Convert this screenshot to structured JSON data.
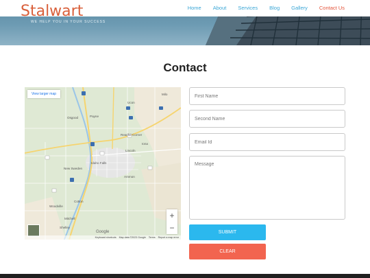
{
  "brand": {
    "logo": "Stalwart",
    "tagline": "WE HELP YOU IN YOUR SUCCESS"
  },
  "nav": {
    "items": [
      {
        "label": "Home",
        "active": false
      },
      {
        "label": "About",
        "active": false
      },
      {
        "label": "Services",
        "active": false
      },
      {
        "label": "Blog",
        "active": false
      },
      {
        "label": "Gallery",
        "active": false
      },
      {
        "label": "Contact Us",
        "active": true
      }
    ]
  },
  "page": {
    "title": "Contact"
  },
  "map": {
    "view_larger": "View larger map",
    "zoom_in": "+",
    "zoom_out": "−",
    "google": "Google",
    "footer": {
      "shortcuts": "Keyboard shortcuts",
      "data": "Map data ©2023 Google",
      "terms": "Terms",
      "report": "Report a map error"
    },
    "places": {
      "milo": "Milo",
      "ucon": "Ucon",
      "osgood": "Osgood",
      "payne": "Payne",
      "roberts_corner": "Reache Corner",
      "iona": "Iona",
      "lincoln": "Lincoln",
      "idaho_falls": "Idaho Falls",
      "new_sweden": "New Sweden",
      "ammon": "Ammon",
      "cotton": "Cotton",
      "woodville": "Woodville",
      "mitchell": "Mitchell",
      "shelley": "Shelley"
    }
  },
  "form": {
    "first_name": {
      "placeholder": "First Name",
      "value": ""
    },
    "second_name": {
      "placeholder": "Second Name",
      "value": ""
    },
    "email": {
      "placeholder": "Email Id",
      "value": ""
    },
    "message": {
      "placeholder": "Message",
      "value": ""
    },
    "submit_label": "SUBMIT",
    "clear_label": "CLEAR"
  },
  "colors": {
    "brand": "#d9603b",
    "nav_link": "#3aa6d6",
    "nav_active": "#e4543b",
    "submit": "#2bb8ee",
    "clear": "#f2644f"
  }
}
